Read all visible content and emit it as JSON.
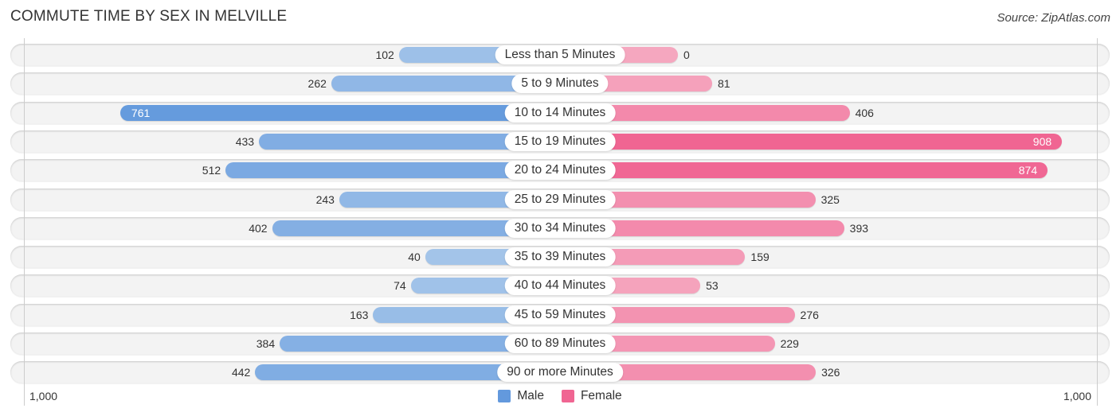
{
  "header": {
    "title": "COMMUTE TIME BY SEX IN MELVILLE",
    "source": "Source: ZipAtlas.com"
  },
  "colors": {
    "male_strong": "#6399dd",
    "male_light": "#a6c6ea",
    "female_strong": "#f06592",
    "female_light": "#f5a7bf"
  },
  "chart_data": {
    "type": "bar",
    "orientation": "horizontal-diverging",
    "title": "COMMUTE TIME BY SEX IN MELVILLE",
    "categories": [
      "Less than 5 Minutes",
      "5 to 9 Minutes",
      "10 to 14 Minutes",
      "15 to 19 Minutes",
      "20 to 24 Minutes",
      "25 to 29 Minutes",
      "30 to 34 Minutes",
      "35 to 39 Minutes",
      "40 to 44 Minutes",
      "45 to 59 Minutes",
      "60 to 89 Minutes",
      "90 or more Minutes"
    ],
    "series": [
      {
        "name": "Male",
        "side": "left",
        "values": [
          102,
          262,
          761,
          433,
          512,
          243,
          402,
          40,
          74,
          163,
          384,
          442
        ]
      },
      {
        "name": "Female",
        "side": "right",
        "values": [
          0,
          81,
          406,
          908,
          874,
          325,
          393,
          159,
          53,
          276,
          229,
          326
        ]
      }
    ],
    "value_labels": {
      "Male": [
        "102",
        "262",
        "761",
        "433",
        "512",
        "243",
        "402",
        "40",
        "74",
        "163",
        "384",
        "442"
      ],
      "Female": [
        "0",
        "81",
        "406",
        "908",
        "874",
        "325",
        "393",
        "159",
        "53",
        "276",
        "229",
        "326"
      ]
    },
    "xlim": [
      -1000,
      1000
    ],
    "tick_labels": {
      "left": "1,000",
      "right": "1,000"
    },
    "legend": {
      "position": "bottom-center",
      "entries": [
        "Male",
        "Female"
      ]
    },
    "grid": false
  }
}
